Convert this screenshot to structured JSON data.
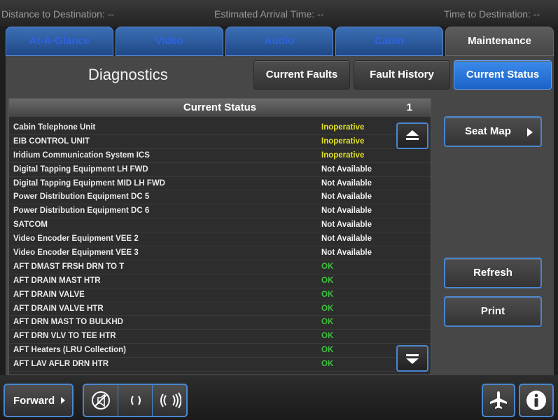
{
  "topbar": {
    "distance": "Distance to Destination: --",
    "eta": "Estimated Arrival Time: --",
    "time_to_dest": "Time to Destination: --"
  },
  "tabs": [
    {
      "label": "At-A-Glance",
      "active": false
    },
    {
      "label": "Video",
      "active": false
    },
    {
      "label": "Audio",
      "active": false
    },
    {
      "label": "Cabin",
      "active": false
    },
    {
      "label": "Maintenance",
      "active": true
    }
  ],
  "diagnostics": {
    "title": "Diagnostics",
    "buttons": {
      "current_faults": "Current Faults",
      "fault_history": "Fault History",
      "current_status": "Current Status"
    }
  },
  "status_list": {
    "title": "Current Status",
    "page": "1",
    "rows": [
      {
        "name": "Cabin Telephone Unit",
        "status": "Inoperative"
      },
      {
        "name": "EIB CONTROL UNIT",
        "status": "Inoperative"
      },
      {
        "name": "Iridium Communication System ICS",
        "status": "Inoperative"
      },
      {
        "name": "Digital Tapping Equipment LH FWD",
        "status": "Not Available"
      },
      {
        "name": "Digital Tapping Equipment MID LH FWD",
        "status": "Not Available"
      },
      {
        "name": "Power Distribution Equipment DC 5",
        "status": "Not Available"
      },
      {
        "name": "Power Distribution Equipment DC 6",
        "status": "Not Available"
      },
      {
        "name": " SATCOM",
        "status": "Not Available"
      },
      {
        "name": "Video Encoder Equipment VEE 2",
        "status": "Not Available"
      },
      {
        "name": "Video Encoder Equipment VEE 3",
        "status": "Not Available"
      },
      {
        "name": "AFT DMAST FRSH DRN TO T",
        "status": "OK"
      },
      {
        "name": "AFT DRAIN MAST HTR",
        "status": "OK"
      },
      {
        "name": "AFT DRAIN VALVE",
        "status": "OK"
      },
      {
        "name": "AFT DRAIN VALVE HTR",
        "status": "OK"
      },
      {
        "name": "AFT DRN MAST TO BULKHD",
        "status": "OK"
      },
      {
        "name": "AFT DRN VLV TO TEE HTR",
        "status": "OK"
      },
      {
        "name": "AFT Heaters (LRU Collection)",
        "status": "OK"
      },
      {
        "name": "AFT LAV AFLR DRN HTR",
        "status": "OK"
      }
    ]
  },
  "side_buttons": {
    "seat_map": "Seat Map",
    "refresh": "Refresh",
    "print": "Print"
  },
  "bottombar": {
    "forward": "Forward"
  },
  "icons": {
    "scroll_top": "double-up-arrow-icon",
    "scroll_bottom": "double-down-arrow-icon",
    "mute": "mute-icon",
    "volume_down": "volume-down-icon",
    "volume_up": "volume-up-icon",
    "airplane": "airplane-icon",
    "info": "info-icon"
  },
  "colors": {
    "tab_blue": "#2f63e0",
    "active_button": "#2a78e0",
    "inoperative": "#e2e22a",
    "not_available": "#f0f0f0",
    "ok": "#3fbf3f"
  }
}
